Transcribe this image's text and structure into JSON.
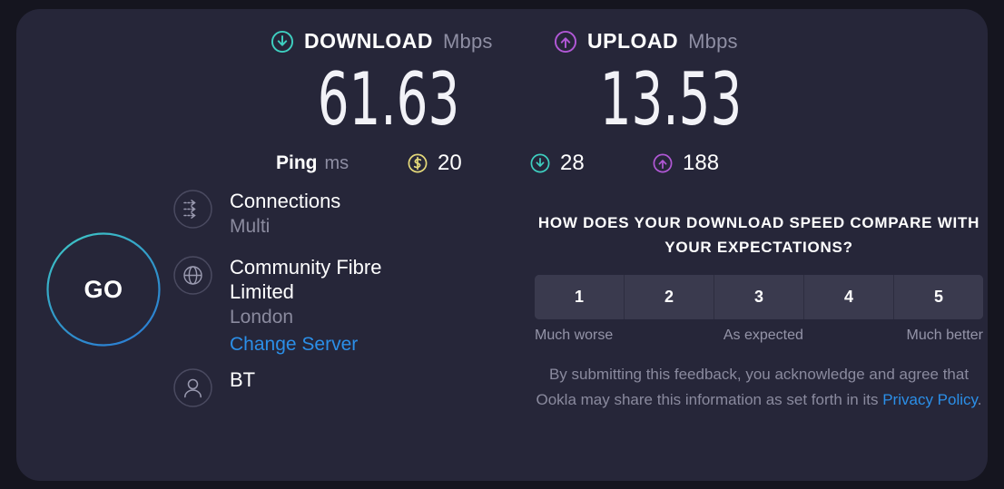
{
  "theme": {
    "page_bg": "#15151f",
    "card_bg": "#262639",
    "download_accent": "#3ecfc0",
    "upload_accent": "#b158d6",
    "idle_accent": "#e5d97a",
    "link_blue": "#2b8fe8",
    "muted_text": "#8a8a9e",
    "go_ring_top": "#3ec6c6",
    "go_ring_bottom": "#2b7fd4"
  },
  "results": {
    "download": {
      "icon": "download-arrow-circle-icon",
      "label": "DOWNLOAD",
      "unit": "Mbps",
      "value": "61.63"
    },
    "upload": {
      "icon": "upload-arrow-circle-icon",
      "label": "UPLOAD",
      "unit": "Mbps",
      "value": "13.53"
    }
  },
  "ping": {
    "label": "Ping",
    "unit": "ms",
    "idle": {
      "icon": "idle-latency-icon",
      "value": "20"
    },
    "download": {
      "icon": "download-arrow-circle-icon",
      "value": "28"
    },
    "upload": {
      "icon": "upload-arrow-circle-icon",
      "value": "188"
    }
  },
  "go_button": {
    "label": "GO"
  },
  "connection_info": {
    "connections": {
      "icon": "multi-connection-arrows-icon",
      "title": "Connections",
      "subtitle": "Multi"
    },
    "server": {
      "icon": "globe-icon",
      "name": "Community Fibre Limited",
      "location": "London",
      "change_link": "Change Server"
    },
    "client": {
      "icon": "person-icon",
      "isp": "BT"
    }
  },
  "feedback": {
    "question": "HOW DOES YOUR DOWNLOAD SPEED COMPARE WITH YOUR EXPECTATIONS?",
    "ratings": [
      "1",
      "2",
      "3",
      "4",
      "5"
    ],
    "scale": {
      "low": "Much worse",
      "mid": "As expected",
      "high": "Much better"
    },
    "disclaimer_before": "By submitting this feedback, you acknowledge and agree that Ookla may share this information as set forth in its ",
    "disclaimer_link": "Privacy Policy",
    "disclaimer_after": "."
  }
}
